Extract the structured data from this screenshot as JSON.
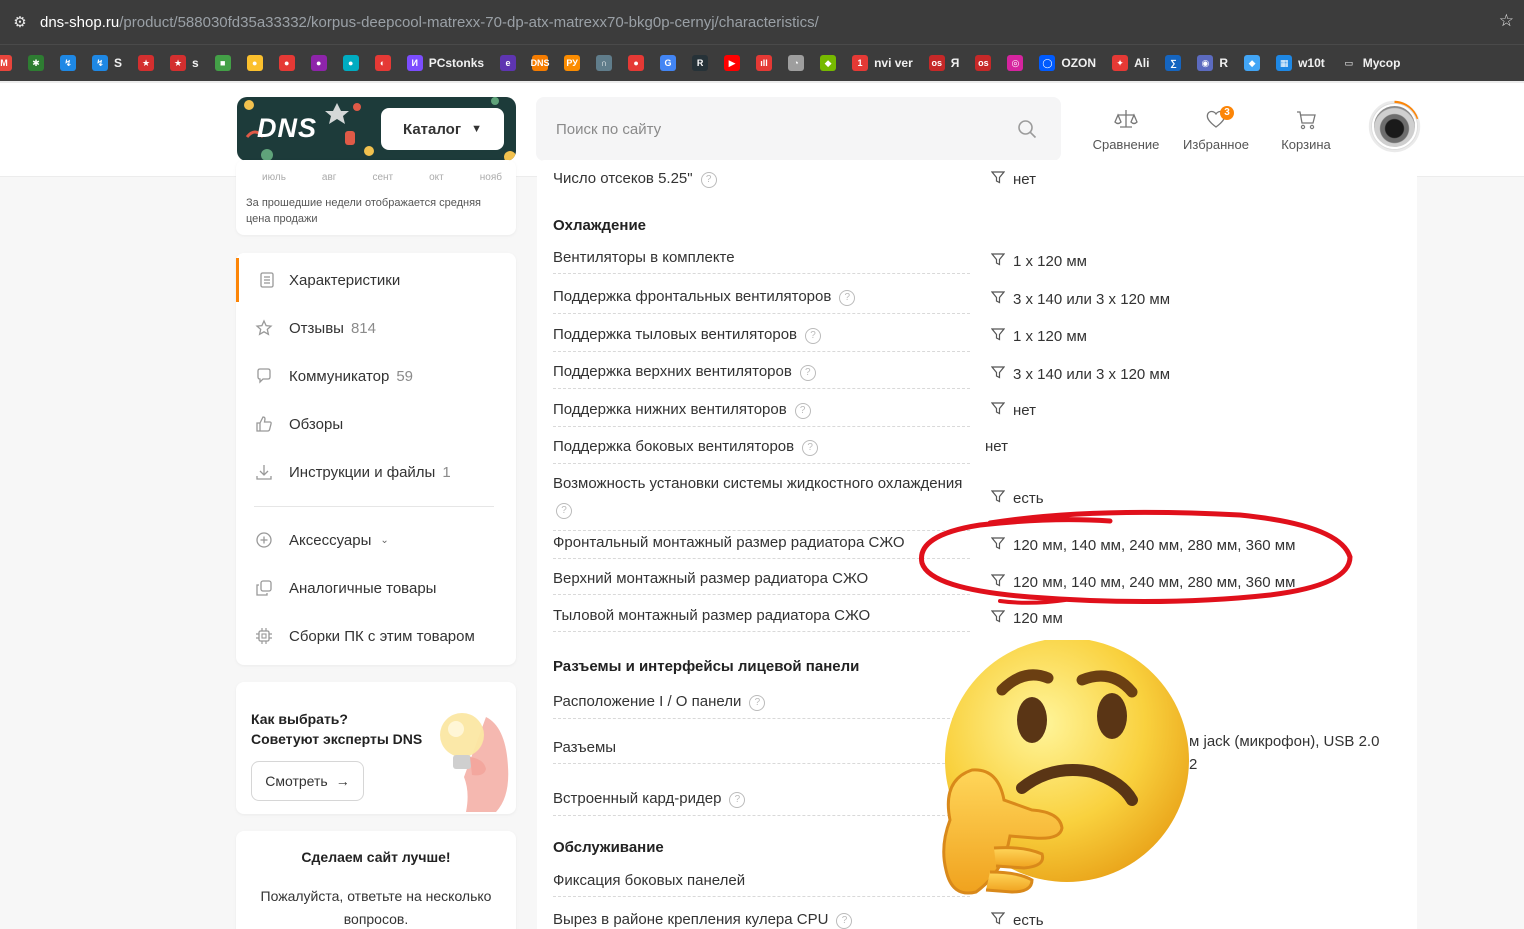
{
  "browser": {
    "url_host": "dns-shop.ru",
    "url_path": "/product/588030fd35a33332/korpus-deepcool-matrexx-70-dp-atx-matrexx70-bkg0p-cernyj/characteristics/",
    "bookmarks": [
      {
        "label": "",
        "color": "#e8453c",
        "glyph": "M"
      },
      {
        "label": "",
        "color": "#2e7d32",
        "glyph": "✱"
      },
      {
        "label": "",
        "color": "#1e88e5",
        "glyph": "↯"
      },
      {
        "label": "S",
        "color": "#1e88e5",
        "glyph": "↯"
      },
      {
        "label": "",
        "color": "#d32f2f",
        "glyph": "★"
      },
      {
        "label": "s",
        "color": "#d32f2f",
        "glyph": "★"
      },
      {
        "label": "",
        "color": "#43a047",
        "glyph": "■"
      },
      {
        "label": "",
        "color": "#fbc02d",
        "glyph": "●"
      },
      {
        "label": "",
        "color": "#e53935",
        "glyph": "●"
      },
      {
        "label": "",
        "color": "#8e24aa",
        "glyph": "●"
      },
      {
        "label": "",
        "color": "#00acc1",
        "glyph": "●"
      },
      {
        "label": "",
        "color": "#e53935",
        "glyph": "◐"
      },
      {
        "label": "PCstonks",
        "color": "#7c4dff",
        "glyph": "И"
      },
      {
        "label": "",
        "color": "#5e35b1",
        "glyph": "e"
      },
      {
        "label": "",
        "color": "#f57c00",
        "glyph": "DNS"
      },
      {
        "label": "",
        "color": "#fb8c00",
        "glyph": "РУ"
      },
      {
        "label": "",
        "color": "#607d8b",
        "glyph": "∩"
      },
      {
        "label": "",
        "color": "#e53935",
        "glyph": "●"
      },
      {
        "label": "",
        "color": "#4285f4",
        "glyph": "G"
      },
      {
        "label": "",
        "color": "#263238",
        "glyph": "R"
      },
      {
        "label": "",
        "color": "#ff0000",
        "glyph": "▶"
      },
      {
        "label": "",
        "color": "#e53935",
        "glyph": "ıll"
      },
      {
        "label": "",
        "color": "#9e9e9e",
        "glyph": "◔"
      },
      {
        "label": "",
        "color": "#76b900",
        "glyph": "◆"
      },
      {
        "label": "nvi ver",
        "color": "#e53935",
        "glyph": "1"
      },
      {
        "label": "Я",
        "color": "#c62828",
        "glyph": "os"
      },
      {
        "label": "",
        "color": "#c62828",
        "glyph": "os"
      },
      {
        "label": "",
        "color": "#d6249f",
        "glyph": "◎"
      },
      {
        "label": "OZON",
        "color": "#005bff",
        "glyph": "◯"
      },
      {
        "label": "Ali",
        "color": "#e53935",
        "glyph": "✦"
      },
      {
        "label": "",
        "color": "#1565c0",
        "glyph": "∑"
      },
      {
        "label": "R",
        "color": "#5c6bc0",
        "glyph": "◉"
      },
      {
        "label": "",
        "color": "#42a5f5",
        "glyph": "◆"
      },
      {
        "label": "w10t",
        "color": "#1e88e5",
        "glyph": "▦"
      },
      {
        "label": "Мусор",
        "color": "#3c3c3c",
        "glyph": "▭"
      }
    ]
  },
  "header": {
    "logo": "DNS",
    "catalog_label": "Каталог",
    "search_placeholder": "Поиск по сайту",
    "compare_label": "Сравнение",
    "favorites_label": "Избранное",
    "favorites_count": "3",
    "cart_label": "Корзина"
  },
  "price_card": {
    "months": [
      "июль",
      "авг",
      "сент",
      "окт",
      "нояб"
    ],
    "note": "За прошедшие недели отображается средняя цена продажи"
  },
  "nav": {
    "characteristics": {
      "label": "Характеристики"
    },
    "reviews": {
      "label": "Отзывы",
      "count": "814"
    },
    "communicator": {
      "label": "Коммуникатор",
      "count": "59"
    },
    "overviews": {
      "label": "Обзоры"
    },
    "files": {
      "label": "Инструкции и файлы",
      "count": "1"
    },
    "accessories": {
      "label": "Аксессуары"
    },
    "similar": {
      "label": "Аналогичные товары"
    },
    "builds": {
      "label": "Сборки ПК с этим товаром"
    }
  },
  "tips": {
    "title_line1": "Как выбрать?",
    "title_line2": "Советуют эксперты DNS",
    "button": "Смотреть"
  },
  "survey": {
    "title": "Сделаем сайт лучше!",
    "text": "Пожалуйста, ответьте на несколько вопросов."
  },
  "specs": {
    "top_cut": {
      "name": "Число отсеков 5.25\"",
      "value": "нет"
    },
    "cooling_title": "Охлаждение",
    "cooling": [
      {
        "name": "Вентиляторы в комплекте",
        "value": "1 x 120 мм"
      },
      {
        "name": "Поддержка фронтальных вентиляторов",
        "value": "3 x 140 или 3 x 120 мм"
      },
      {
        "name": "Поддержка тыловых вентиляторов",
        "value": "1 x 120 мм"
      },
      {
        "name": "Поддержка верхних вентиляторов",
        "value": "3 x 140 или 3 x 120 мм"
      },
      {
        "name": "Поддержка нижних вентиляторов",
        "value": "нет"
      },
      {
        "name": "Поддержка боковых вентиляторов",
        "value": "нет"
      },
      {
        "name": "Возможность установки системы жидкостного охлаждения",
        "value": "есть"
      },
      {
        "name": "Фронтальный монтажный размер радиатора СЖО",
        "value": "120 мм, 140 мм, 240 мм, 280 мм, 360 мм"
      },
      {
        "name": "Верхний монтажный размер радиатора СЖО",
        "value": "120 мм, 140 мм, 240 мм, 280 мм, 360 мм"
      },
      {
        "name": "Тыловой монтажный размер радиатора СЖО",
        "value": "120 мм"
      }
    ],
    "front_panel_title": "Разъемы и интерфейсы лицевой панели",
    "front_panel": [
      {
        "name": "Расположение I / O панели",
        "value": ""
      },
      {
        "name": "Разъемы",
        "value_line1": "м jack (микрофон), USB 2.0",
        "value_line2": "2"
      },
      {
        "name": "Встроенный кард-ридер",
        "value": ""
      }
    ],
    "service_title": "Обслуживание",
    "service": [
      {
        "name": "Фиксация боковых панелей",
        "value": ""
      },
      {
        "name": "Вырез в районе крепления кулера CPU",
        "value": "есть"
      }
    ]
  },
  "colors": {
    "accent": "#fc8507",
    "annotation": "#e0101b"
  }
}
